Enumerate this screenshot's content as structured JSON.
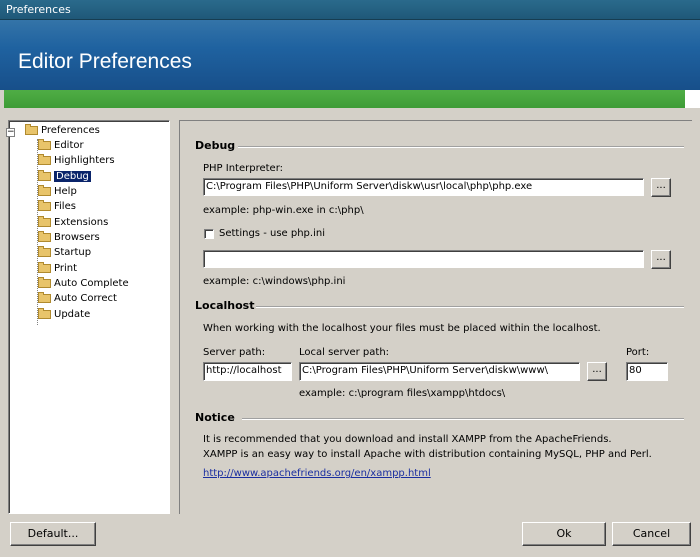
{
  "window": {
    "title": "Preferences"
  },
  "banner": {
    "title": "Editor Preferences"
  },
  "tree": {
    "root": "Preferences",
    "items": [
      {
        "label": "Editor"
      },
      {
        "label": "Highlighters"
      },
      {
        "label": "Debug",
        "selected": true
      },
      {
        "label": "Help"
      },
      {
        "label": "Files"
      },
      {
        "label": "Extensions"
      },
      {
        "label": "Browsers"
      },
      {
        "label": "Startup"
      },
      {
        "label": "Print"
      },
      {
        "label": "Auto Complete"
      },
      {
        "label": "Auto Correct"
      },
      {
        "label": "Update"
      }
    ]
  },
  "debug": {
    "heading": "Debug",
    "php_label": "PHP Interpreter:",
    "php_value": "C:\\Program Files\\PHP\\Uniform Server\\diskw\\usr\\local\\php\\php.exe",
    "php_example": "example: php-win.exe in c:\\php\\",
    "settings_label": "Settings - use php.ini",
    "settings_checked": false,
    "ini_value": "",
    "ini_example": "example: c:\\windows\\php.ini",
    "browse_label": "..."
  },
  "localhost": {
    "heading": "Localhost",
    "description": "When working with the localhost your files must be placed within the localhost.",
    "server_path_label": "Server path:",
    "server_path_value": "http://localhost",
    "local_path_label": "Local server path:",
    "local_path_value": "C:\\Program Files\\PHP\\Uniform Server\\diskw\\www\\",
    "port_label": "Port:",
    "port_value": "80",
    "local_example": "example: c:\\program files\\xampp\\htdocs\\"
  },
  "notice": {
    "heading": "Notice",
    "line1": "It is recommended that you download and install XAMPP from the ApacheFriends.",
    "line2": "XAMPP is an easy way to install Apache with distribution containing MySQL, PHP and Perl.",
    "link": "http://www.apachefriends.org/en/xampp.html"
  },
  "buttons": {
    "default": "Default...",
    "ok": "Ok",
    "cancel": "Cancel"
  },
  "colors": {
    "banner": "#1f62a0",
    "green_bar": "#4fad45",
    "selection": "#0a246a",
    "link": "#1a2ea0"
  }
}
